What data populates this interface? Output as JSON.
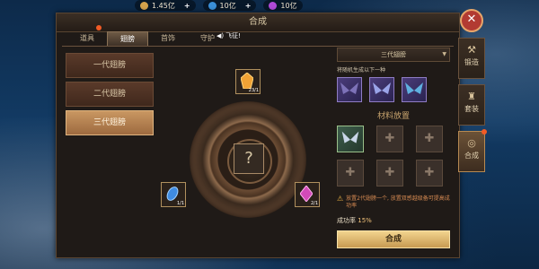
{
  "currency": [
    {
      "value": "1.45亿",
      "color": "#d4a24c"
    },
    {
      "value": "10亿",
      "color": "#3a8fd8"
    },
    {
      "value": "10亿",
      "color": "#b04ad8"
    }
  ],
  "window": {
    "title": "合成",
    "notice": "飞征!",
    "tabs": [
      {
        "label": "道具",
        "active": false
      },
      {
        "label": "翅膀",
        "active": true
      },
      {
        "label": "首饰",
        "active": false
      },
      {
        "label": "守护",
        "active": false
      }
    ]
  },
  "generations": [
    {
      "label": "一代翅膀",
      "selected": false
    },
    {
      "label": "二代翅膀",
      "selected": false
    },
    {
      "label": "三代翅膀",
      "selected": true
    }
  ],
  "center": {
    "question": "?",
    "slots": [
      {
        "name": "top",
        "count": "23/1",
        "color": "#f0a235",
        "icon": "orange-gem"
      },
      {
        "name": "left",
        "count": "1/1",
        "color": "#3f8be0",
        "icon": "blue-feather"
      },
      {
        "name": "right",
        "count": "2/1",
        "color": "#d24ab8",
        "icon": "purple-gem"
      }
    ]
  },
  "panel": {
    "header": "三代翅膀",
    "subtitle": "将随机生成以下一种",
    "wing_options": [
      "wing-option-icon",
      "wing-option-icon",
      "wing-option-icon"
    ],
    "material_title": "材料放置",
    "tip": "放置2代翅膀一个, 放置双感越级备可提高成功率",
    "rate_label": "成功率",
    "rate_value": "15%",
    "button": "合成"
  },
  "side_tabs": [
    {
      "label": "锻造",
      "active": false
    },
    {
      "label": "套装",
      "active": false
    },
    {
      "label": "合成",
      "active": true
    }
  ]
}
